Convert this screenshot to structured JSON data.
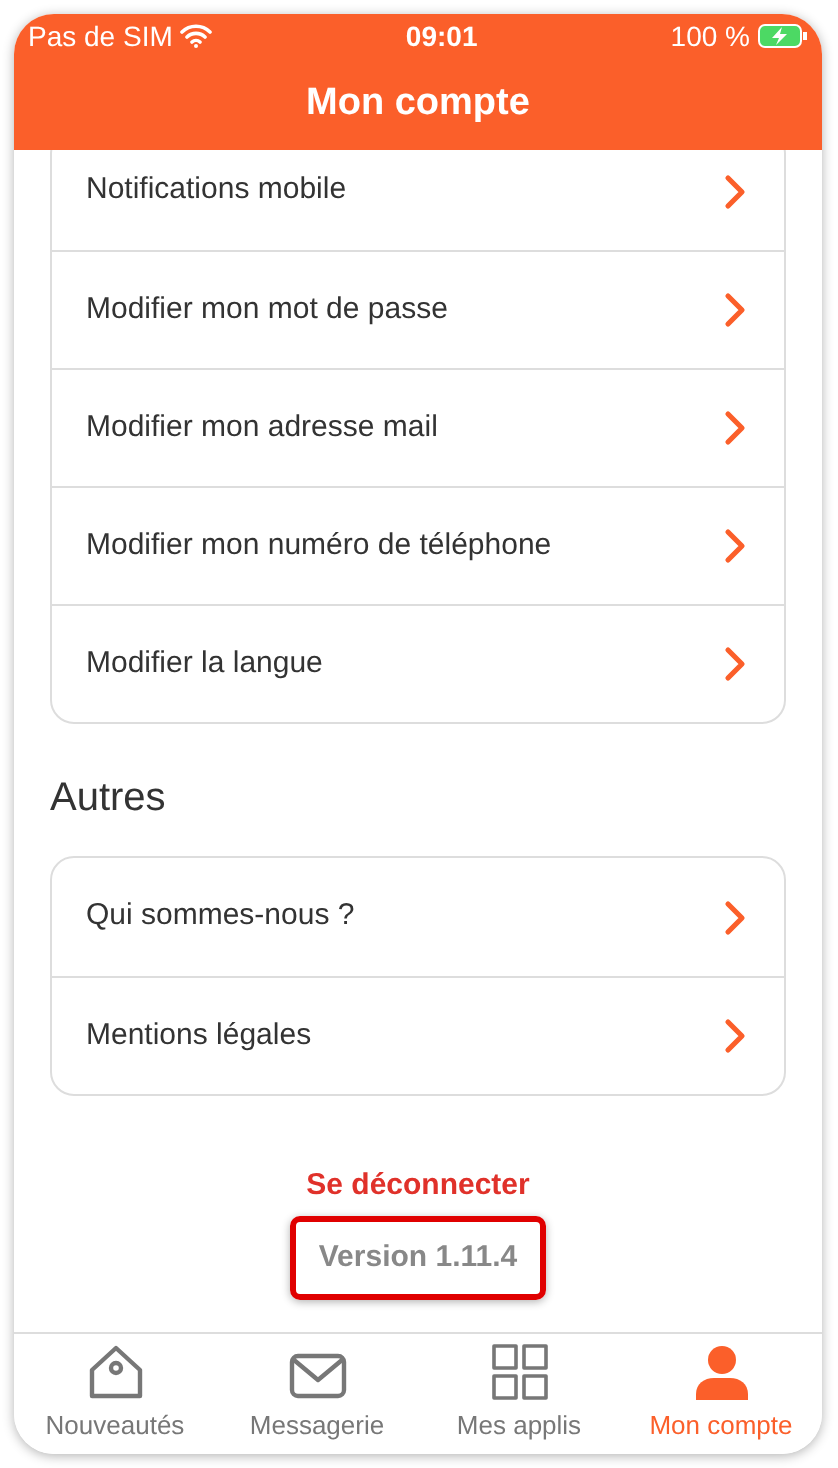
{
  "status_bar": {
    "carrier": "Pas de SIM",
    "time": "09:01",
    "battery": "100 %"
  },
  "header": {
    "title": "Mon compte"
  },
  "sections": [
    {
      "items": [
        "Notifications mobile",
        "Modifier mon mot de passe",
        "Modifier mon adresse mail",
        "Modifier mon numéro de téléphone",
        "Modifier la langue"
      ]
    },
    {
      "title": "Autres",
      "items": [
        "Qui sommes-nous ?",
        "Mentions légales"
      ]
    }
  ],
  "logout": "Se déconnecter",
  "version": {
    "text": "Version 1.11.4",
    "highlighted": true
  },
  "tab_bar": [
    {
      "label": "Nouveautés",
      "kind": "home",
      "selected": false
    },
    {
      "label": "Messagerie",
      "kind": "mail",
      "selected": false
    },
    {
      "label": "Mes applis",
      "kind": "grid",
      "selected": false
    },
    {
      "label": "Mon compte",
      "kind": "person",
      "selected": true
    }
  ]
}
